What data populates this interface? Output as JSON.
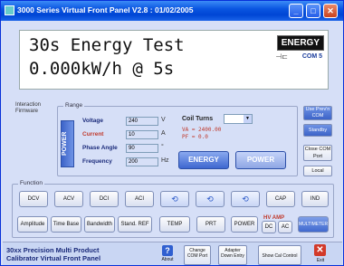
{
  "window": {
    "title": "3000 Series Virtual Front Panel V2.8 : 01/02/2005",
    "min_glyph": "_",
    "max_glyph": "□",
    "close_glyph": "✕"
  },
  "display": {
    "line1": "30s Energy Test",
    "line2": "0.000kW/h @ 5s",
    "mode_badge": "ENERGY",
    "com_port": "COM 5"
  },
  "side": {
    "interaction_label": "Interaction",
    "firmware_label": "Firmware"
  },
  "range": {
    "group_label": "Range",
    "power_tab": "POWER",
    "params": [
      {
        "label": "Voltage",
        "value": "240",
        "unit": "V"
      },
      {
        "label": "Current",
        "value": "10",
        "unit": "A"
      },
      {
        "label": "Phase Angle",
        "value": "90",
        "unit": "°"
      },
      {
        "label": "Frequency",
        "value": "200",
        "unit": "Hz"
      }
    ],
    "coil_turns_label": "Coil Turns",
    "coil_line1": "VA = 2400.00",
    "coil_line2": "PF = 0.0",
    "energy_btn": "ENERGY",
    "power_btn": "POWER"
  },
  "right_panel": {
    "btn1": "Use Prev'n COM",
    "btn2": "Standby",
    "btn3": "Close COM Port",
    "btn4": "Local"
  },
  "function": {
    "group_label": "Function",
    "row1": [
      "DCV",
      "ACV",
      "DCI",
      "ACI",
      "⟲",
      "⟲",
      "⟲",
      "CAP",
      "IND"
    ],
    "row2": [
      "Amplitude",
      "Time Base",
      "Bandwidth",
      "Stand. REF",
      "TEMP",
      "PRT",
      "POWER",
      "DC",
      "AC",
      "MULTIMETER"
    ],
    "hv_label": "HV AMP"
  },
  "footer": {
    "title": "30xx Precision Multi Product Calibrator Virtual Front Panel",
    "about": "About",
    "change_com": "Change COM Port",
    "adapter": "Adapter Down Entry",
    "show_control": "Show Cal Control",
    "exit": "Exit"
  }
}
